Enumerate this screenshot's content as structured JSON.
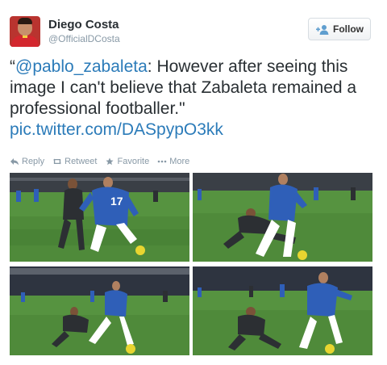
{
  "user": {
    "name": "Diego Costa",
    "handle": "@OfficialDCosta"
  },
  "follow_button": {
    "label": "Follow"
  },
  "tweet": {
    "open_quote": "“",
    "mention": "@pablo_zabaleta",
    "body": ": However after seeing this image I can't believe that Zabaleta remained a professional footballer.\"",
    "link": "pic.twitter.com/DASpypO3kk"
  },
  "actions": [
    {
      "label": "Reply",
      "icon": "reply-icon"
    },
    {
      "label": "Retweet",
      "icon": "retweet-icon"
    },
    {
      "label": "Favorite",
      "icon": "star-icon"
    },
    {
      "label": "More",
      "icon": "more-icon"
    }
  ],
  "media": {
    "photos": [
      {
        "jersey_number": "17"
      },
      {
        "jersey_number": ""
      },
      {
        "jersey_number": ""
      },
      {
        "jersey_number": ""
      }
    ]
  },
  "colors": {
    "link": "#2b7bb9",
    "text": "#292f33",
    "muted": "#8899a6",
    "pitch": "#4f8a3a",
    "chelsea_blue": "#2f5fb8",
    "city_dark": "#2c2f33"
  }
}
